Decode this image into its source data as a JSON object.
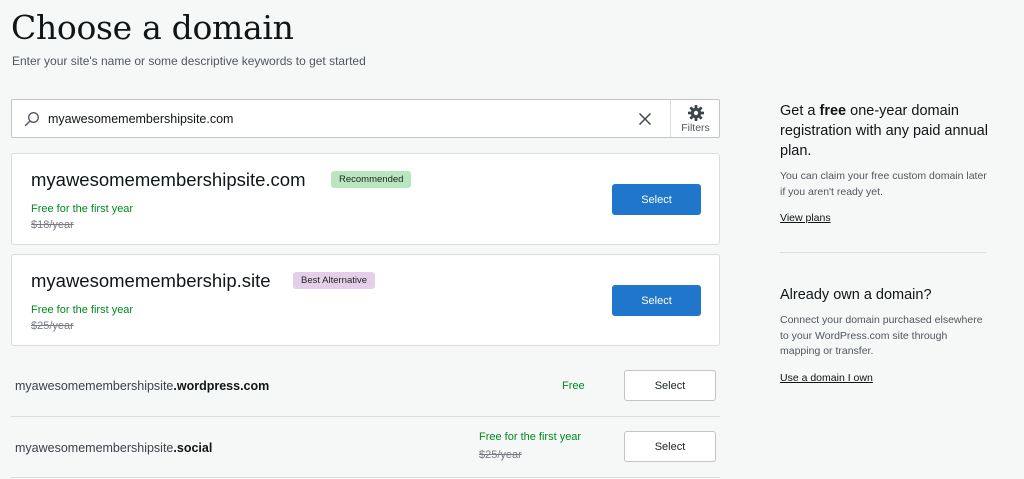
{
  "page": {
    "title": "Choose a domain",
    "subtitle": "Enter your site's name or some descriptive keywords to get started"
  },
  "search": {
    "query": "myawesomemembershipsite.com",
    "filters_label": "Filters",
    "icons": {
      "search": "search-icon",
      "clear": "close-icon",
      "filters": "gear-icon"
    }
  },
  "featured": [
    {
      "domain": "myawesomemembershipsite.com",
      "badge": "Recommended",
      "badge_color": "#b8e6bf",
      "price_note": "Free for the first year",
      "original_price": "$18/year",
      "button": "Select"
    },
    {
      "domain": "myawesomemembership.site",
      "badge": "Best Alternative",
      "badge_color": "#e5cfe8",
      "price_note": "Free for the first year",
      "original_price": "$25/year",
      "button": "Select"
    }
  ],
  "results": [
    {
      "name": "myawesomemembershipsite",
      "tld": ".wordpress.com",
      "price_note": "Free",
      "original_price": "",
      "button": "Select"
    },
    {
      "name": "myawesomemembershipsite",
      "tld": ".social",
      "price_note": "Free for the first year",
      "original_price": "$25/year",
      "button": "Select"
    }
  ],
  "sidebar": {
    "promo": {
      "title_pre": "Get a ",
      "title_bold": "free",
      "title_post": " one-year domain registration with any paid annual plan.",
      "body": "You can claim your free custom domain later if you aren't ready yet.",
      "link": "View plans"
    },
    "own": {
      "title": "Already own a domain?",
      "body": "Connect your domain purchased elsewhere to your WordPress.com site through mapping or transfer.",
      "link": "Use a domain I own"
    }
  },
  "colors": {
    "primary_button": "#1f76ca",
    "free_text": "#008a20",
    "background": "#f6f7f7"
  }
}
